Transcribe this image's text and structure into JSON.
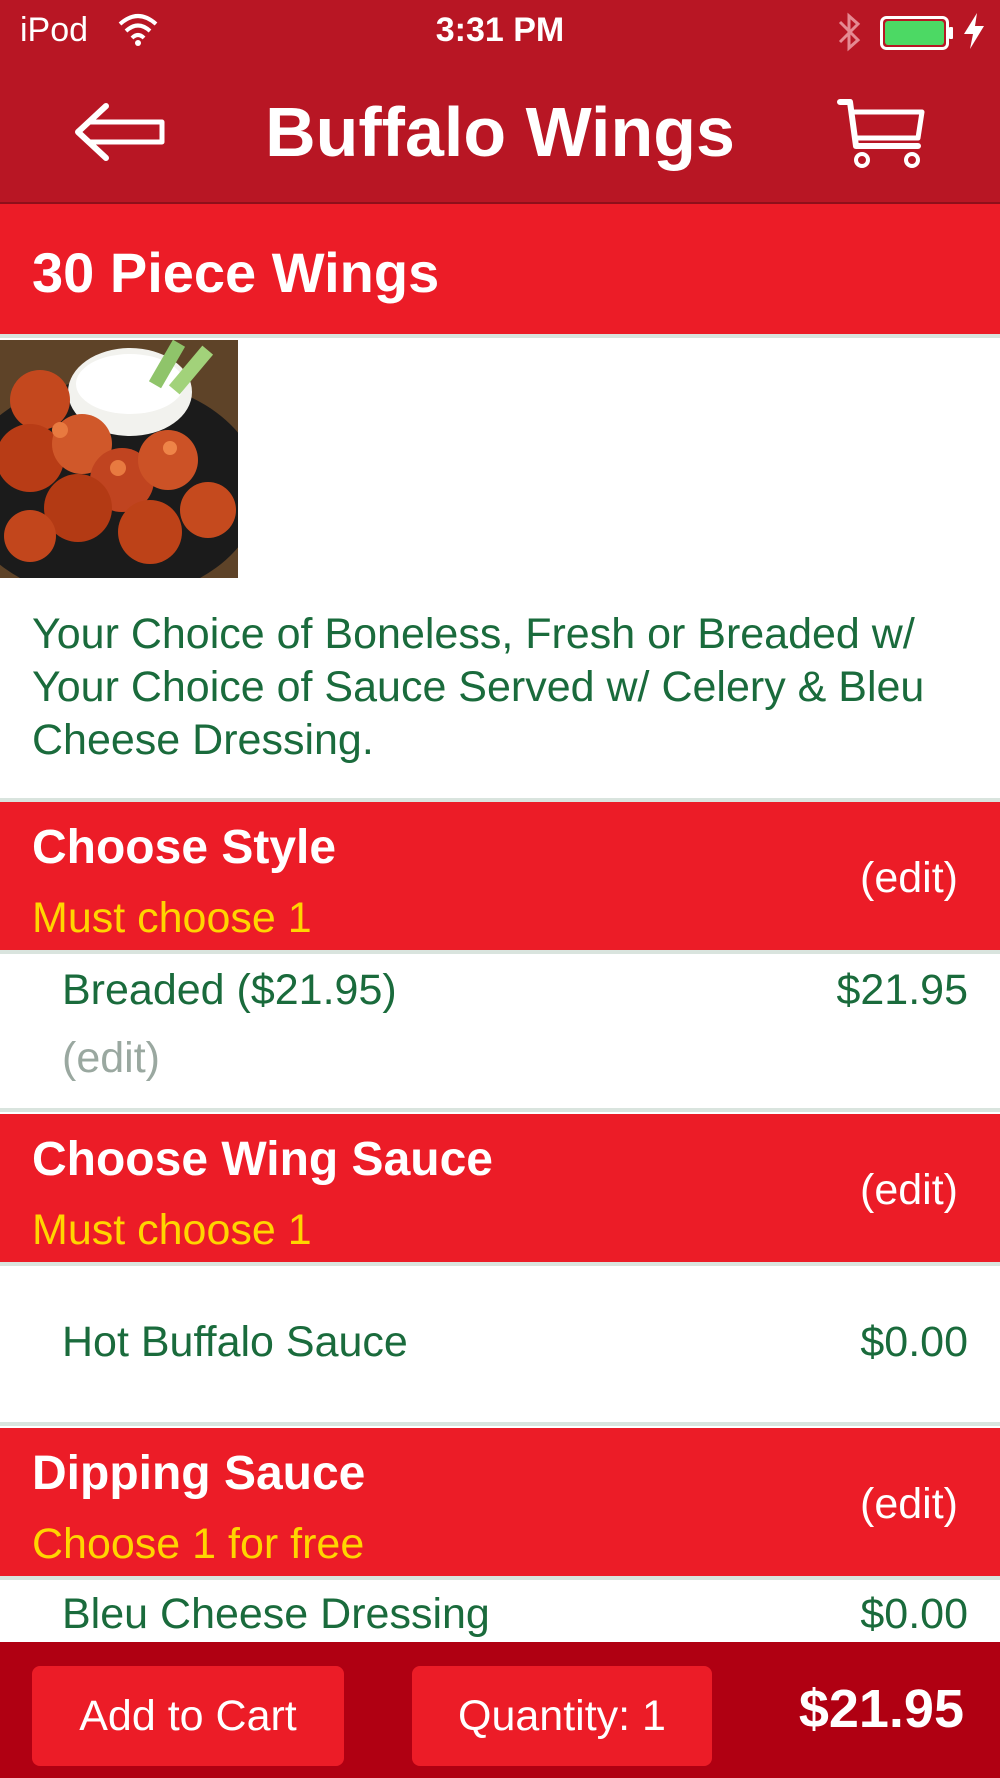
{
  "status_bar": {
    "carrier": "iPod",
    "time": "3:31 PM",
    "icons": [
      "wifi-icon",
      "bluetooth-icon",
      "battery-icon",
      "charging-icon"
    ]
  },
  "nav": {
    "title": "Buffalo Wings",
    "back_icon": "back-arrow-icon",
    "cart_icon": "cart-icon"
  },
  "item": {
    "name": "30 Piece Wings",
    "image": "buffalo-wings-photo",
    "description": "Your Choice of Boneless, Fresh or Breaded w/ Your Choice of Sauce Served w/ Celery & Bleu Cheese Dressing."
  },
  "sections": [
    {
      "title": "Choose Style",
      "requirement": "Must choose 1",
      "edit_label": "(edit)",
      "selection": {
        "name": "Breaded ($21.95)",
        "price": "$21.95",
        "edit_label": "(edit)"
      }
    },
    {
      "title": "Choose Wing Sauce",
      "requirement": "Must choose 1",
      "edit_label": "(edit)",
      "selection": {
        "name": "Hot Buffalo Sauce",
        "price": "$0.00"
      }
    },
    {
      "title": "Dipping Sauce",
      "requirement": "Choose 1 for free",
      "edit_label": "(edit)",
      "selection": {
        "name": "Bleu Cheese Dressing",
        "price": "$0.00"
      }
    }
  ],
  "bottom_bar": {
    "add_to_cart": "Add to Cart",
    "quantity": "Quantity: 1",
    "total": "$21.95"
  },
  "colors": {
    "bar_red": "#b81624",
    "section_red": "#ec1c27",
    "bottom_red": "#b00012",
    "text_green": "#1a6b3c",
    "requirement_yellow": "#ffd500",
    "muted_gray": "#9aa8a0"
  }
}
